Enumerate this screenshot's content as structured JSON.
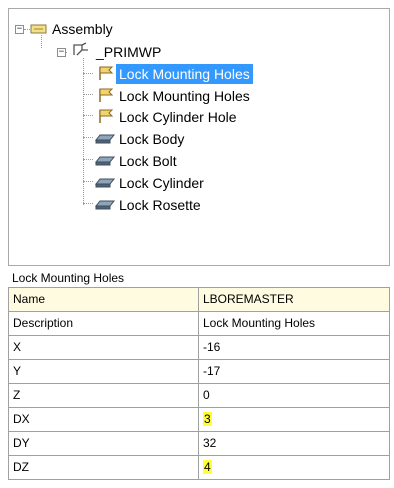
{
  "tree": {
    "root_label": "Assembly",
    "child_label": "_PRIMWP",
    "items": [
      {
        "label": "Lock Mounting Holes",
        "icon": "flag-icon"
      },
      {
        "label": "Lock Mounting Holes",
        "icon": "flag-icon"
      },
      {
        "label": "Lock Cylinder Hole",
        "icon": "flag-icon"
      },
      {
        "label": "Lock Body",
        "icon": "part-icon"
      },
      {
        "label": "Lock Bolt",
        "icon": "part-icon"
      },
      {
        "label": "Lock Cylinder",
        "icon": "part-icon"
      },
      {
        "label": "Lock Rosette",
        "icon": "part-icon"
      }
    ],
    "selected_index": 0,
    "selection_color": "#3399ff"
  },
  "properties": {
    "title": "Lock Mounting Holes",
    "rows": [
      {
        "key": "Name",
        "value": "LBOREMASTER"
      },
      {
        "key": "Description",
        "value": "Lock Mounting Holes"
      },
      {
        "key": "X",
        "value": "-16"
      },
      {
        "key": "Y",
        "value": "-17"
      },
      {
        "key": "Z",
        "value": "0"
      },
      {
        "key": "DX",
        "value": "3"
      },
      {
        "key": "DY",
        "value": "32"
      },
      {
        "key": "DZ",
        "value": "4"
      }
    ],
    "highlight_color": "#ffff33"
  }
}
